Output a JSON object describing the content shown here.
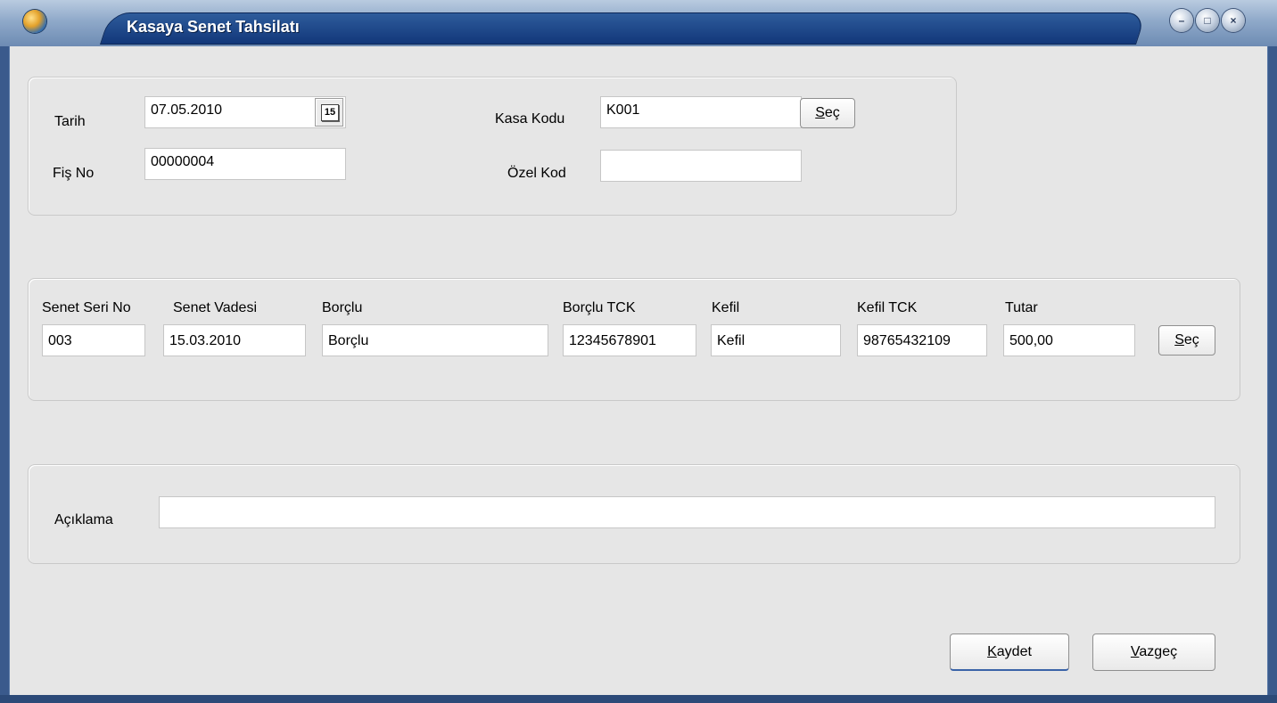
{
  "window": {
    "title": "Kasaya Senet Tahsilatı",
    "buttons": {
      "minimize": "–",
      "maximize": "□",
      "close": "×"
    }
  },
  "header": {
    "date_label": "Tarih",
    "date_value": "07.05.2010",
    "calendar_glyph": "15",
    "fis_label": "Fiş No",
    "fis_value": "00000004",
    "kasa_label": "Kasa Kodu",
    "kasa_value": "K001",
    "kasa_select_prefix": "S",
    "kasa_select_rest": "eç",
    "ozel_label": "Özel Kod",
    "ozel_value": ""
  },
  "senet": {
    "columns": {
      "seri": "Senet Seri No",
      "vade": "Senet Vadesi",
      "borclu": "Borçlu",
      "borclu_tck": "Borçlu TCK",
      "kefil": "Kefil",
      "kefil_tck": "Kefil TCK",
      "tutar": "Tutar"
    },
    "values": {
      "seri": "003",
      "vade": "15.03.2010",
      "borclu": "Borçlu",
      "borclu_tck": "12345678901",
      "kefil": "Kefil",
      "kefil_tck": "98765432109",
      "tutar": "500,00"
    },
    "select_prefix": "S",
    "select_rest": "eç"
  },
  "aciklama": {
    "label": "Açıklama",
    "value": ""
  },
  "footer": {
    "save_prefix": "K",
    "save_rest": "aydet",
    "cancel_prefix": "V",
    "cancel_rest": "azgeç"
  },
  "colors": {
    "titlebar_tab": "#12377a",
    "client_bg": "#e6e6e6",
    "frame": "#3a5a8c"
  },
  "icons": {
    "app": "globe-icon",
    "calendar": "calendar-icon"
  }
}
